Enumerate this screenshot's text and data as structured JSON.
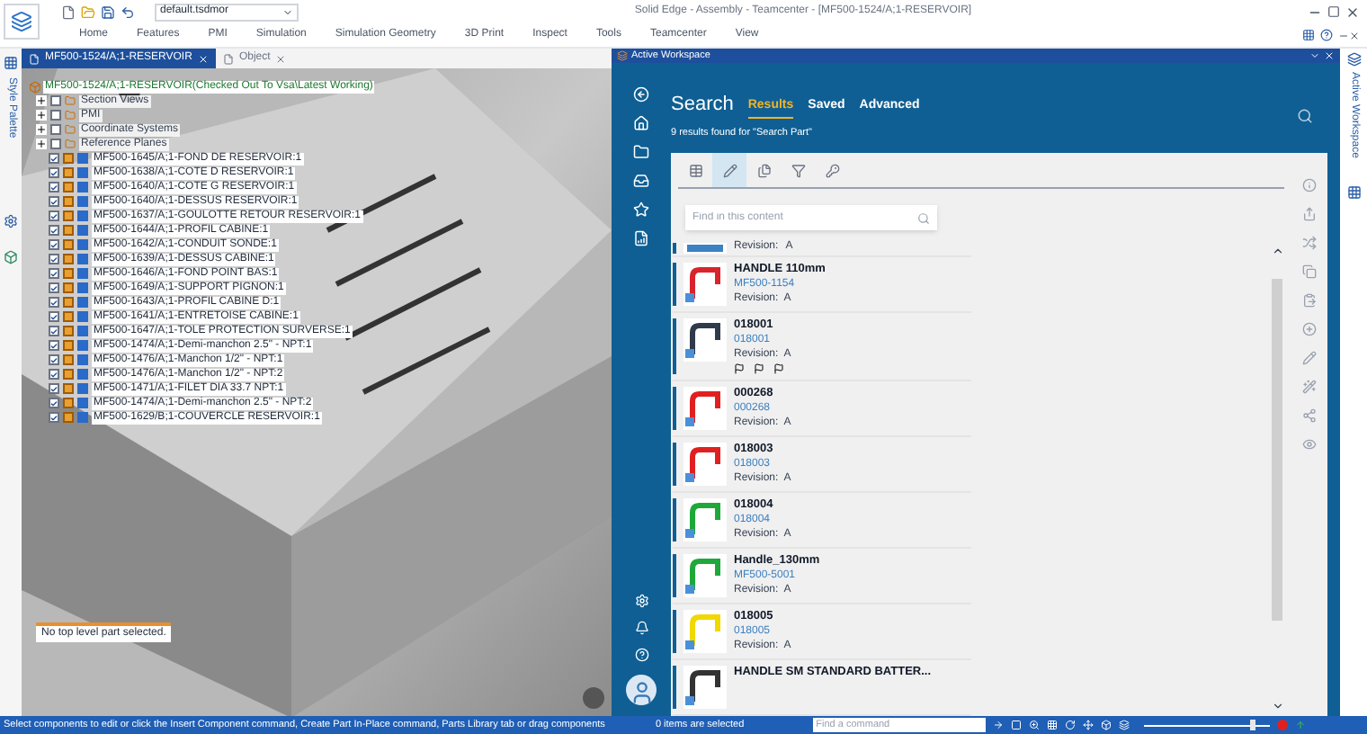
{
  "app_title": "Solid Edge - Assembly - Teamcenter - [MF500-1524/A;1-RESERVOIR]",
  "template": "default.tsdmor",
  "ribbon_tabs": [
    "Home",
    "Features",
    "PMI",
    "Simulation",
    "Simulation Geometry",
    "3D Print",
    "Inspect",
    "Tools",
    "Teamcenter",
    "View"
  ],
  "side_palette": "Style Palette",
  "document_tabs": [
    {
      "label": "MF500-1524/A;1-RESERVOIR",
      "selected": true
    },
    {
      "label": "Object",
      "selected": false
    }
  ],
  "tree": {
    "root": "MF500-1524/A;1-RESERVOIR(Checked Out To Vsa\\Latest Working)",
    "groups": [
      {
        "label": "Section Views",
        "checked": false
      },
      {
        "label": "PMI",
        "checked": false
      },
      {
        "label": "Coordinate Systems",
        "checked": false
      },
      {
        "label": "Reference Planes",
        "checked": false
      }
    ],
    "parts": [
      {
        "label": "MF500-1645/A;1-FOND DE RESERVOIR:1",
        "checked": true
      },
      {
        "label": "MF500-1638/A;1-COTE D RESERVOIR:1",
        "checked": true
      },
      {
        "label": "MF500-1640/A;1-COTE G RESERVOIR:1",
        "checked": true
      },
      {
        "label": "MF500-1640/A;1-DESSUS RESERVOIR:1",
        "checked": true
      },
      {
        "label": "MF500-1637/A;1-GOULOTTE RETOUR RESERVOIR:1",
        "checked": true
      },
      {
        "label": "MF500-1644/A;1-PROFIL CABINE:1",
        "checked": true
      },
      {
        "label": "MF500-1642/A;1-CONDUIT SONDE:1",
        "checked": true
      },
      {
        "label": "MF500-1639/A;1-DESSUS CABINE:1",
        "checked": true
      },
      {
        "label": "MF500-1646/A;1-FOND POINT BAS:1",
        "checked": true
      },
      {
        "label": "MF500-1649/A;1-SUPPORT PIGNON:1",
        "checked": true
      },
      {
        "label": "MF500-1643/A;1-PROFIL CABINE D:1",
        "checked": true
      },
      {
        "label": "MF500-1641/A;1-ENTRETOISE CABINE:1",
        "checked": true
      },
      {
        "label": "MF500-1647/A;1-TOLE PROTECTION SURVERSE:1",
        "checked": true
      },
      {
        "label": "MF500-1474/A;1-Demi-manchon 2.5\" - NPT:1",
        "checked": true
      },
      {
        "label": "MF500-1476/A;1-Manchon 1/2\" - NPT:1",
        "checked": true
      },
      {
        "label": "MF500-1476/A;1-Manchon 1/2\" - NPT:2",
        "checked": true
      },
      {
        "label": "MF500-1471/A;1-FILET DIA 33.7 NPT:1",
        "checked": true
      },
      {
        "label": "MF500-1474/A;1-Demi-manchon 2.5\" - NPT:2",
        "checked": true
      },
      {
        "label": "MF500-1629/B;1-COUVERCLE RESERVOIR:1",
        "checked": true
      }
    ]
  },
  "viewport_message": "No top level part selected.",
  "workspace": {
    "title": "Active Workspace",
    "heading": "Search",
    "tabs": [
      {
        "label": "Results",
        "selected": true
      },
      {
        "label": "Saved",
        "selected": false
      },
      {
        "label": "Advanced",
        "selected": false
      }
    ],
    "summary": "9 results found for \"Search Part\"",
    "tool_tabs": [
      {
        "kind": "table",
        "selected": false
      },
      {
        "kind": "edit",
        "selected": true
      },
      {
        "kind": "file",
        "selected": false
      },
      {
        "kind": "filter",
        "selected": false
      },
      {
        "kind": "key",
        "selected": false
      }
    ],
    "filter_placeholder": "Find in this content",
    "results": [
      {
        "revision_label": "Revision:",
        "revision": "A",
        "color": "#3b82c4"
      },
      {
        "title": "HANDLE 110mm",
        "id": "MF500-1154",
        "revision_label": "Revision:",
        "revision": "A",
        "color": "#d8242c"
      },
      {
        "title": "018001",
        "id": "018001",
        "revision_label": "Revision:",
        "revision": "A",
        "color": "#2f3a4a",
        "flags": [
          {
            "kind": "flag"
          },
          {
            "kind": "flag"
          },
          {
            "kind": "flag"
          }
        ]
      },
      {
        "title": "000268",
        "id": "000268",
        "revision_label": "Revision:",
        "revision": "A",
        "color": "#e02020"
      },
      {
        "title": "018003",
        "id": "018003",
        "revision_label": "Revision:",
        "revision": "A",
        "color": "#e02020"
      },
      {
        "title": "018004",
        "id": "018004",
        "revision_label": "Revision:",
        "revision": "A",
        "color": "#1fa83a"
      },
      {
        "title": "Handle_130mm",
        "id": "MF500-5001",
        "revision_label": "Revision:",
        "revision": "A",
        "color": "#1fa83a"
      },
      {
        "title": "018005",
        "id": "018005",
        "revision_label": "Revision:",
        "revision": "A",
        "color": "#f0d800"
      },
      {
        "title": "HANDLE SM STANDARD BATTER...",
        "color": "#333333"
      }
    ]
  },
  "side_tab": "Active Workspace",
  "status_bar": {
    "prompt": "Select components to edit or click the Insert Component command, Create Part In-Place command, Parts Library tab or drag components",
    "selection": "0 items are selected",
    "command_placeholder": "Find a command",
    "zoom": {
      "level": 0.86
    }
  }
}
